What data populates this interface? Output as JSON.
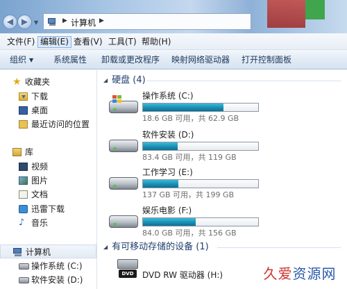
{
  "address": {
    "path": "计算机"
  },
  "menu": [
    {
      "label": "文件(F)"
    },
    {
      "label": "编辑(E)"
    },
    {
      "label": "查看(V)"
    },
    {
      "label": "工具(T)"
    },
    {
      "label": "帮助(H)"
    }
  ],
  "toolbar": {
    "organize": "组织",
    "system_properties": "系统属性",
    "uninstall": "卸载或更改程序",
    "map_drive": "映射网络驱动器",
    "control_panel": "打开控制面板"
  },
  "nav": {
    "favorites": "收藏夹",
    "downloads": "下载",
    "desktop": "桌面",
    "recent": "最近访问的位置",
    "libraries": "库",
    "videos": "视频",
    "pictures": "图片",
    "documents": "文档",
    "thunder": "迅雷下载",
    "music": "音乐",
    "computer": "计算机",
    "drive_c": "操作系统 (C:)",
    "drive_d": "软件安装 (D:)"
  },
  "sections": {
    "hard_disks": "硬盘 (4)",
    "removable": "有可移动存储的设备 (1)"
  },
  "drives": [
    {
      "name": "操作系统 (C:)",
      "space": "18.6 GB 可用，共 62.9 GB",
      "used_fraction": 0.7
    },
    {
      "name": "软件安装 (D:)",
      "space": "83.4 GB 可用，共 119 GB",
      "used_fraction": 0.3
    },
    {
      "name": "工作学习 (E:)",
      "space": "137 GB 可用，共 199 GB",
      "used_fraction": 0.31
    },
    {
      "name": "娱乐电影 (F:)",
      "space": "84.0 GB 可用，共 156 GB",
      "used_fraction": 0.46
    }
  ],
  "dvd": {
    "name": "DVD RW 驱动器 (H:)",
    "badge": "DVD"
  },
  "watermark": {
    "part1": "久爱",
    "part2": "资源网"
  },
  "colors": {
    "bar_fill": "#1a93b8",
    "section_title": "#1e3e6e",
    "toolbar_text": "#1e395b"
  }
}
